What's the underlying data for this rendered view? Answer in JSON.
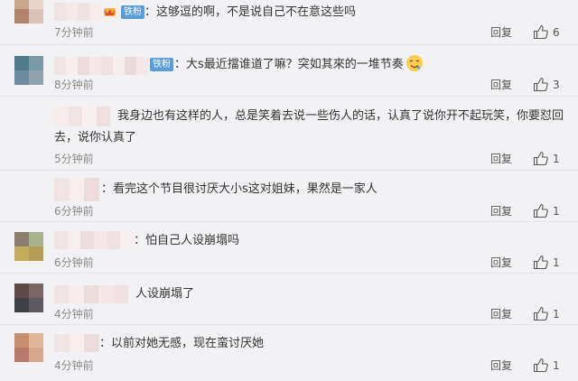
{
  "badge_label": "铁粉",
  "reply_label": "回复",
  "colors": {
    "badge": "#5b9bd8",
    "meta": "#8a8a8a",
    "text": "#333333",
    "background": "#f2f2f5"
  },
  "icons": {
    "like": "thumbs-up-icon",
    "crown": "crown-icon",
    "emoji": "drooling-face-emoji"
  },
  "comments": [
    {
      "text": "：这够逗的啊，不是说自己不在意这些吗",
      "time": "7分钟前",
      "likes": "6"
    },
    {
      "text": "：大s最近擋谁道了嘛？突如其來的一堆节奏",
      "time": "8分钟前",
      "likes": "3"
    },
    {
      "text": "我身边也有这样的人，总是笑着去说一些伤人的话，认真了说你开不起玩笑，你要怼回去，说你认真了",
      "time": "5分钟前",
      "likes": "1"
    },
    {
      "text": "：看完这个节目很讨厌大小s这对姐妹，果然是一家人",
      "time": "6分钟前",
      "likes": "1"
    },
    {
      "text": "：怕自己人设崩塌吗",
      "time": "6分钟前",
      "likes": "1"
    },
    {
      "text": "人设崩塌了",
      "time": "4分钟前",
      "likes": "1"
    },
    {
      "text": "：以前对她无感，现在蛮讨厌她",
      "time": "4分钟前",
      "likes": "1"
    }
  ]
}
